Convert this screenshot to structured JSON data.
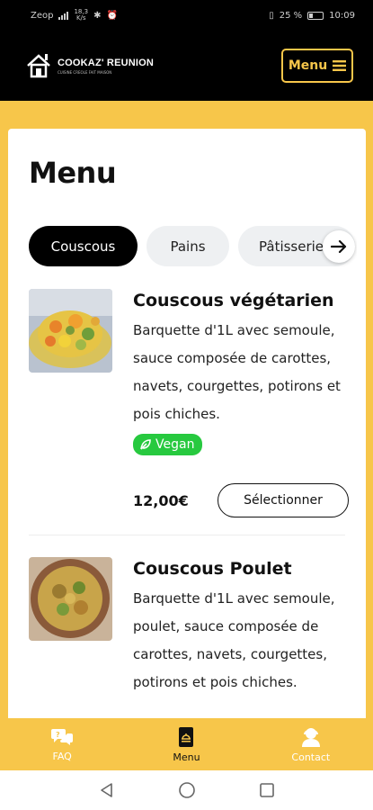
{
  "status_bar": {
    "carrier": "Zeop",
    "speed_top": "18,3",
    "speed_bottom": "K/s",
    "battery": "25 %",
    "time": "10:09"
  },
  "header": {
    "brand_name": "COOKAZ' REUNION",
    "brand_tagline": "CUISINE CREOLE FAIT MAISON",
    "menu_button_label": "Menu"
  },
  "page": {
    "title": "Menu",
    "tabs": [
      {
        "label": "Couscous",
        "active": true
      },
      {
        "label": "Pains",
        "active": false
      },
      {
        "label": "Pâtisseries",
        "active": false
      }
    ]
  },
  "items": [
    {
      "name": "Couscous végétarien",
      "description": "Barquette d'1L avec semoule, sauce composée de carottes, navets, courgettes, potirons et pois chiches.",
      "badge": "Vegan",
      "price": "12,00€",
      "button": "Sélectionner"
    },
    {
      "name": "Couscous Poulet",
      "description": "Barquette d'1L avec semoule, poulet, sauce composée de carottes, navets, courgettes, potirons et pois chiches."
    }
  ],
  "bottom_nav": [
    {
      "label": "FAQ",
      "icon": "faq-icon",
      "active": false
    },
    {
      "label": "Menu",
      "icon": "menu-icon",
      "active": true
    },
    {
      "label": "Contact",
      "icon": "contact-icon",
      "active": false
    }
  ],
  "colors": {
    "accent": "#f7c64a",
    "dark": "#000000",
    "vegan": "#27c93f"
  }
}
